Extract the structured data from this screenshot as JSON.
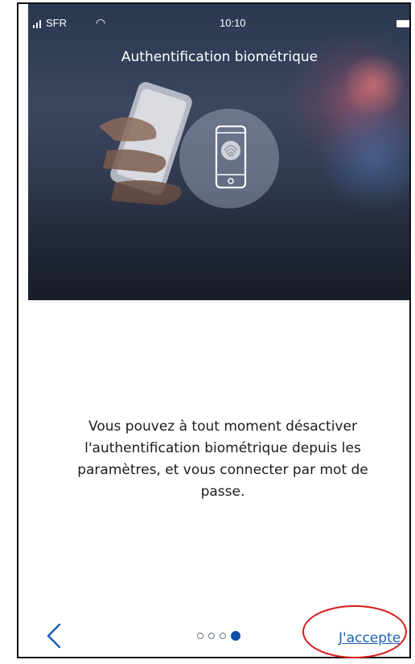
{
  "status_bar": {
    "carrier": "SFR",
    "time": "10:10",
    "icons": [
      "signal-icon",
      "wifi-icon",
      "battery-icon"
    ]
  },
  "hero": {
    "title": "Authentification biométrique",
    "icons": [
      "phone-fingerprint-icon"
    ]
  },
  "body": {
    "message": "Vous pouvez à tout moment désactiver l'authentification biométrique depuis les paramètres, et vous connecter par mot de passe."
  },
  "footer": {
    "back_icon": "chevron-left-icon",
    "pagination": {
      "total": 4,
      "active": 4
    },
    "accept_label": "J'accepte"
  },
  "colors": {
    "link": "#1f5fb3",
    "active_dot": "#0a4ea7",
    "annotation": "#d61a1a",
    "text": "#1c1c1c"
  }
}
